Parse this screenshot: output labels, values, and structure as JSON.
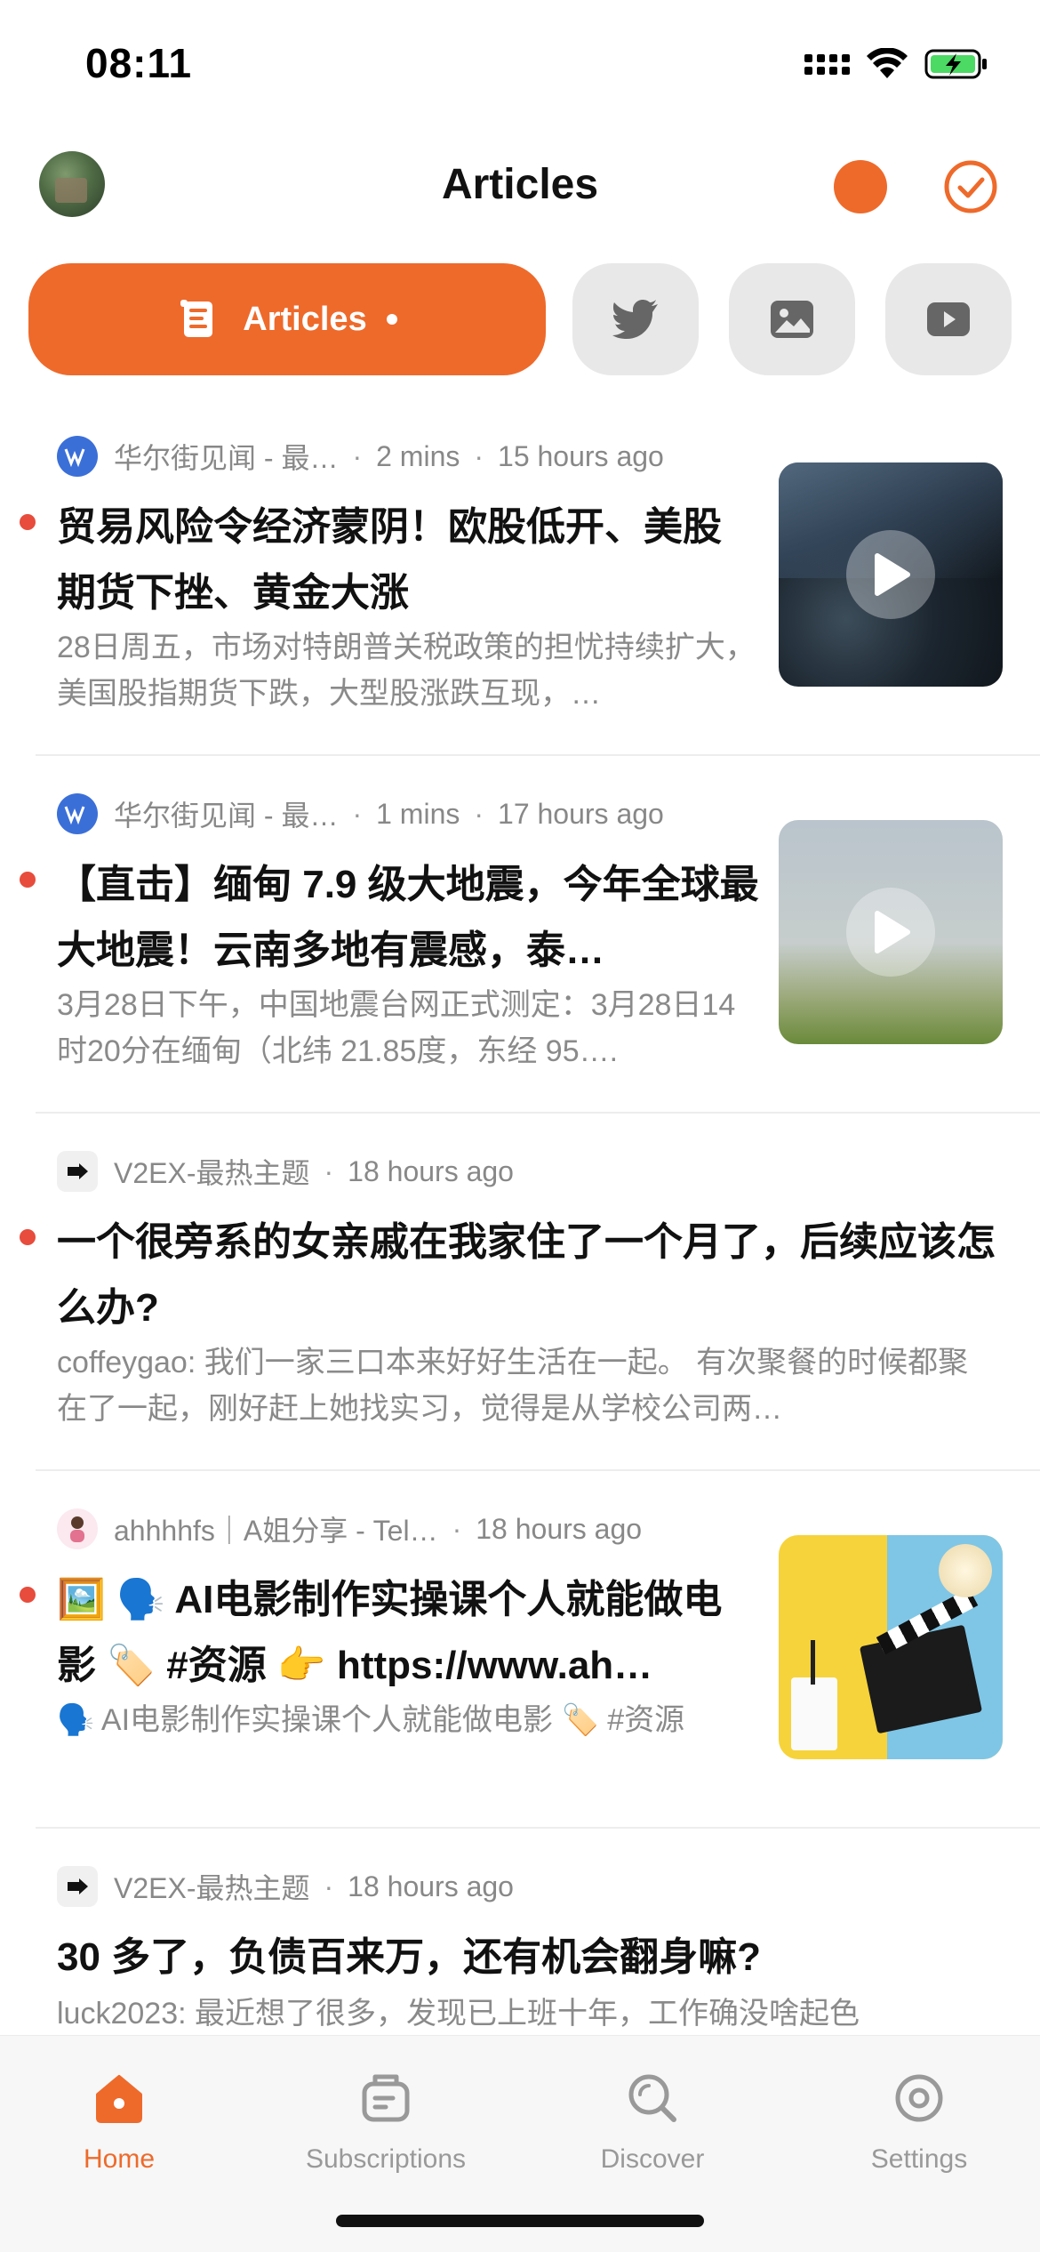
{
  "status_bar": {
    "time": "08:11"
  },
  "header": {
    "title": "Articles"
  },
  "filters": {
    "active_label": "Articles"
  },
  "feed": [
    {
      "source": "华尔街见闻 - 最…",
      "read_time": "2 mins",
      "age": "15 hours ago",
      "title": "贸易风险令经济蒙阴！欧股低开、美股期货下挫、黄金大涨",
      "excerpt": "28日周五，市场对特朗普关税政策的担忧持续扩大，美国股指期货下跌，大型股涨跌互现，…"
    },
    {
      "source": "华尔街见闻 - 最…",
      "read_time": "1 mins",
      "age": "17 hours ago",
      "title": "【直击】缅甸 7.9 级大地震，今年全球最大地震！云南多地有震感，泰…",
      "excerpt": "3月28日下午，中国地震台网正式测定：3月28日14时20分在缅甸（北纬 21.85度，东经 95…."
    },
    {
      "source": "V2EX-最热主题",
      "age": "18 hours ago",
      "title": "一个很旁系的女亲戚在我家住了一个月了，后续应该怎么办?",
      "excerpt": "coffeygao: 我们一家三口本来好好生活在一起。 有次聚餐的时候都聚在了一起，刚好赶上她找实习，觉得是从学校公司两…"
    },
    {
      "source": "ahhhhfs｜A姐分享 - Tel…",
      "age": "18 hours ago",
      "title": "🖼️ 🗣️ AI电影制作实操课个人就能做电影 🏷️ #资源 👉 https://www.ah…",
      "excerpt": "🗣️ AI电影制作实操课个人就能做电影 🏷️ #资源"
    },
    {
      "source": "V2EX-最热主题",
      "age": "18 hours ago",
      "title": "30 多了，负债百来万，还有机会翻身嘛?",
      "excerpt": "luck2023: 最近想了很多，发现已上班十年，工作确没啥起色"
    }
  ],
  "tabbar": {
    "home": "Home",
    "subscriptions": "Subscriptions",
    "discover": "Discover",
    "settings": "Settings"
  },
  "colors": {
    "accent": "#ee6a2b",
    "unread": "#e74c3c"
  }
}
